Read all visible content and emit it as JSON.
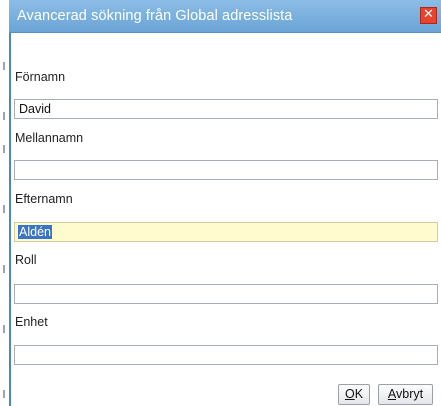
{
  "window": {
    "title": "Avancerad sökning från Global adresslista",
    "close_glyph": "✕"
  },
  "fields": [
    {
      "label": "Förnamn",
      "value": "David"
    },
    {
      "label": "Mellannamn",
      "value": ""
    },
    {
      "label": "Efternamn",
      "value": "Aldén",
      "state": "focused-selected"
    },
    {
      "label": "Roll",
      "value": ""
    },
    {
      "label": "Enhet",
      "value": ""
    }
  ],
  "buttons": {
    "ok_mnemonic": "O",
    "ok_rest": "K",
    "cancel_mnemonic": "A",
    "cancel_rest": "vbryt"
  },
  "colors": {
    "titlebar": "#7ab1de",
    "close": "#e8432e",
    "focused_field": "#fffbcf",
    "selection": "#3b74c4"
  }
}
